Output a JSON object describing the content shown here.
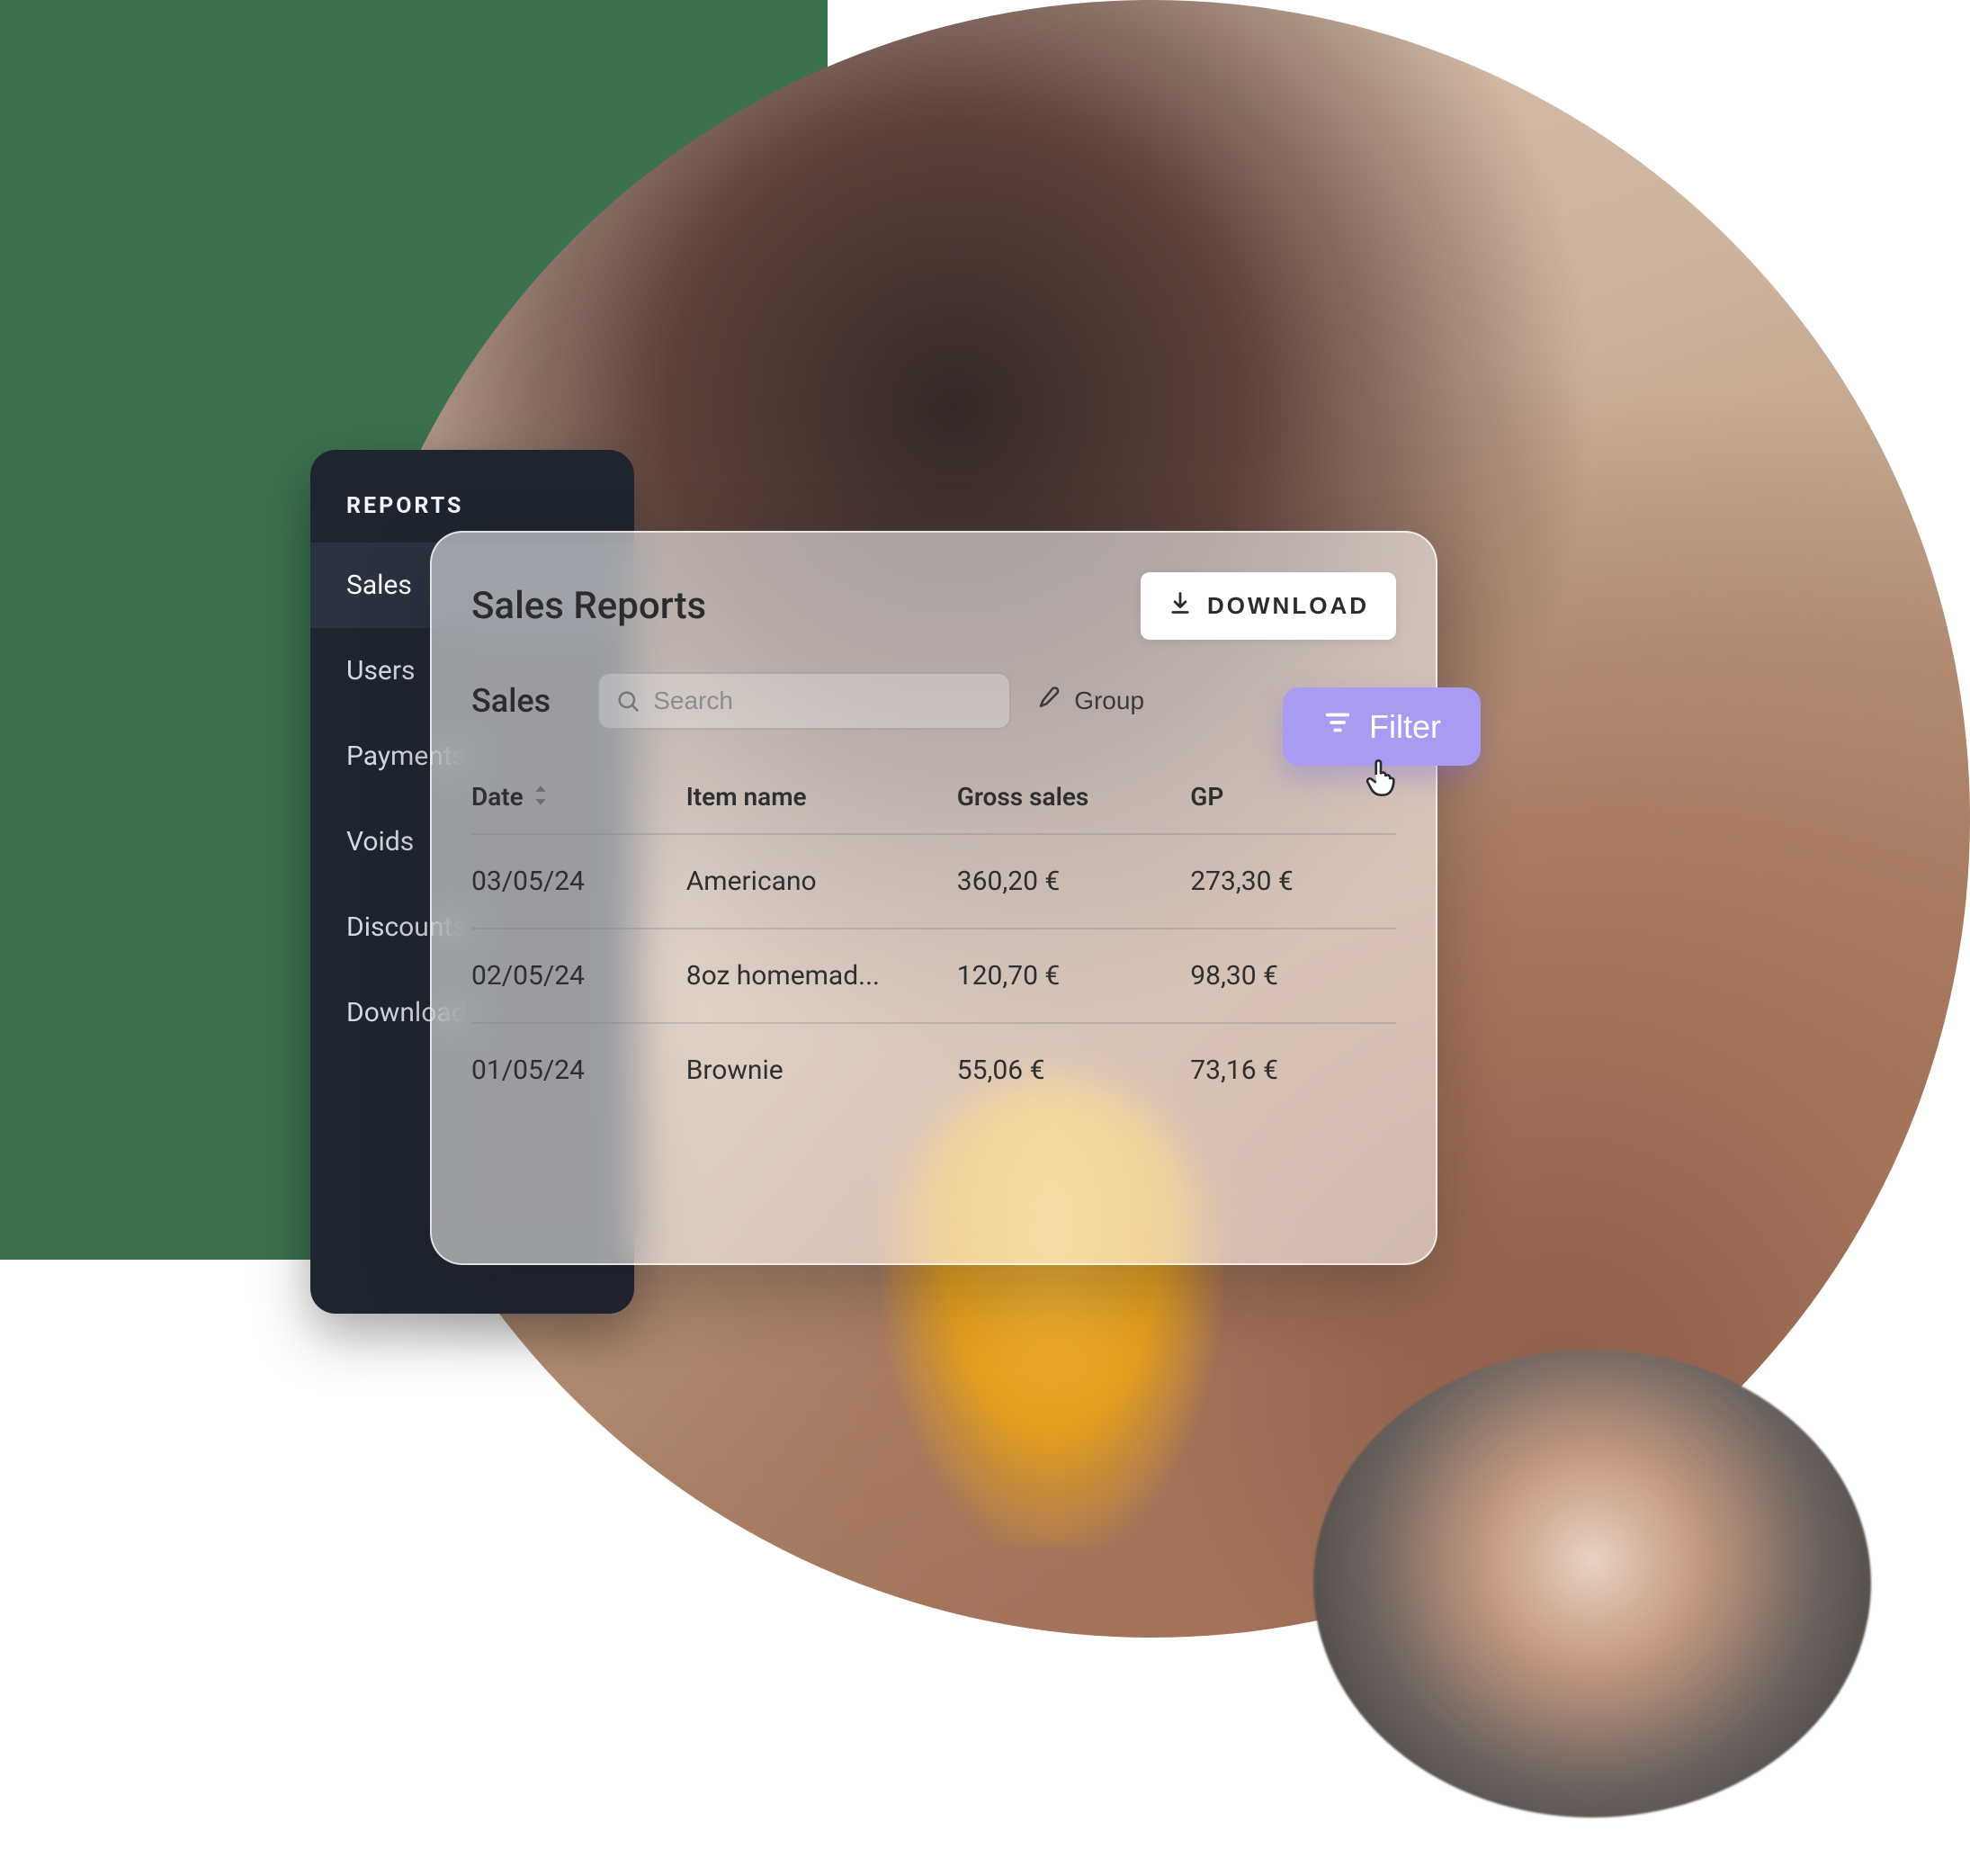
{
  "colors": {
    "green": "#3b714f",
    "sidebar_bg": "#1f2530",
    "filter_bg": "#a99af2"
  },
  "sidebar": {
    "heading": "REPORTS",
    "items": [
      {
        "label": "Sales",
        "active": true
      },
      {
        "label": "Users",
        "active": false
      },
      {
        "label": "Payments",
        "active": false
      },
      {
        "label": "Voids",
        "active": false
      },
      {
        "label": "Discounts",
        "active": false
      },
      {
        "label": "Download",
        "active": false
      }
    ]
  },
  "card": {
    "title": "Sales Reports",
    "download_label": "DOWNLOAD",
    "section_title": "Sales",
    "search_placeholder": "Search",
    "group_label": "Group",
    "filter_label": "Filter"
  },
  "table": {
    "columns": {
      "date": "Date",
      "item": "Item name",
      "gross": "Gross sales",
      "gp": "GP"
    },
    "rows": [
      {
        "date": "03/05/24",
        "item": "Americano",
        "gross": "360,20 €",
        "gp": "273,30 €"
      },
      {
        "date": "02/05/24",
        "item": "8oz homemad...",
        "gross": "120,70 €",
        "gp": "98,30 €"
      },
      {
        "date": "01/05/24",
        "item": "Brownie",
        "gross": "55,06 €",
        "gp": "73,16 €"
      }
    ]
  }
}
